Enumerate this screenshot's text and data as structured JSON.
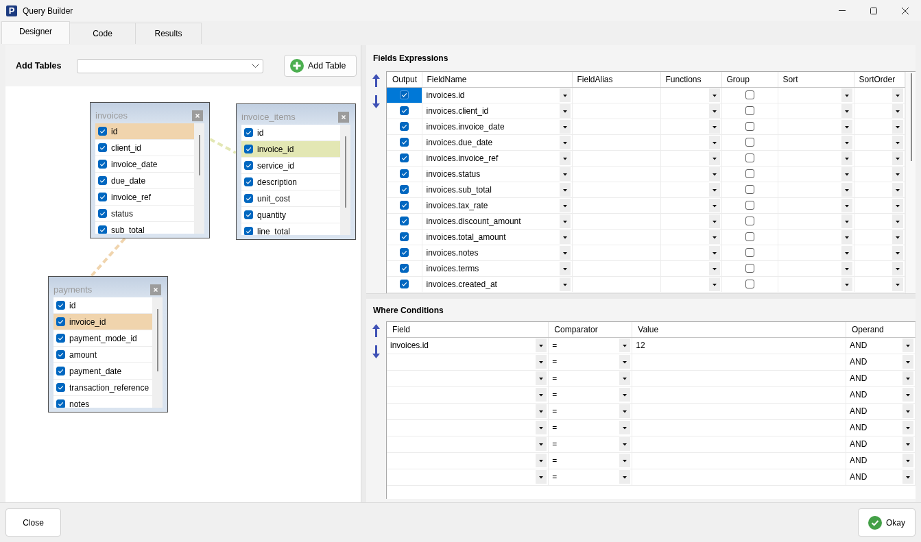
{
  "window": {
    "logo": "P",
    "title": "Query Builder"
  },
  "tabs": [
    {
      "label": "Designer",
      "selected": true
    },
    {
      "label": "Code",
      "selected": false
    },
    {
      "label": "Results",
      "selected": false
    }
  ],
  "designer": {
    "add_tables_label": "Add Tables",
    "add_table_button": "Add Table",
    "tables": [
      {
        "name": "invoices",
        "fields": [
          {
            "name": "id",
            "checked": true,
            "color": "#f0d4ad"
          },
          {
            "name": "client_id",
            "checked": true
          },
          {
            "name": "invoice_date",
            "checked": true
          },
          {
            "name": "due_date",
            "checked": true
          },
          {
            "name": "invoice_ref",
            "checked": true
          },
          {
            "name": "status",
            "checked": true
          },
          {
            "name": "sub_total",
            "checked": true
          }
        ]
      },
      {
        "name": "invoice_items",
        "fields": [
          {
            "name": "id",
            "checked": true
          },
          {
            "name": "invoice_id",
            "checked": true,
            "color": "#e3e7b4"
          },
          {
            "name": "service_id",
            "checked": true
          },
          {
            "name": "description",
            "checked": true
          },
          {
            "name": "unit_cost",
            "checked": true
          },
          {
            "name": "quantity",
            "checked": true
          },
          {
            "name": "line_total",
            "checked": true
          }
        ]
      },
      {
        "name": "payments",
        "fields": [
          {
            "name": "id",
            "checked": true
          },
          {
            "name": "invoice_id",
            "checked": true,
            "color": "#f0d4ad"
          },
          {
            "name": "payment_mode_id",
            "checked": true
          },
          {
            "name": "amount",
            "checked": true
          },
          {
            "name": "payment_date",
            "checked": true
          },
          {
            "name": "transaction_reference",
            "checked": true
          },
          {
            "name": "notes",
            "checked": true
          }
        ]
      }
    ],
    "relations": [
      {
        "color": "#e3e7b4"
      },
      {
        "color": "#f0d4ad"
      }
    ]
  },
  "fields_expressions": {
    "title": "Fields Expressions",
    "columns": [
      "Output",
      "FieldName",
      "FieldAlias",
      "Functions",
      "Group",
      "Sort",
      "SortOrder"
    ],
    "rows": [
      {
        "field_name": "invoices.id",
        "output": true,
        "group": false,
        "selected": true
      },
      {
        "field_name": "invoices.client_id",
        "output": true,
        "group": false,
        "selected": false
      },
      {
        "field_name": "invoices.invoice_date",
        "output": true,
        "group": false,
        "selected": false
      },
      {
        "field_name": "invoices.due_date",
        "output": true,
        "group": false,
        "selected": false
      },
      {
        "field_name": "invoices.invoice_ref",
        "output": true,
        "group": false,
        "selected": false
      },
      {
        "field_name": "invoices.status",
        "output": true,
        "group": false,
        "selected": false
      },
      {
        "field_name": "invoices.sub_total",
        "output": true,
        "group": false,
        "selected": false
      },
      {
        "field_name": "invoices.tax_rate",
        "output": true,
        "group": false,
        "selected": false
      },
      {
        "field_name": "invoices.discount_amount",
        "output": true,
        "group": false,
        "selected": false
      },
      {
        "field_name": "invoices.total_amount",
        "output": true,
        "group": false,
        "selected": false
      },
      {
        "field_name": "invoices.notes",
        "output": true,
        "group": false,
        "selected": false
      },
      {
        "field_name": "invoices.terms",
        "output": true,
        "group": false,
        "selected": false
      },
      {
        "field_name": "invoices.created_at",
        "output": true,
        "group": false,
        "selected": false
      }
    ]
  },
  "where_conditions": {
    "title": "Where Conditions",
    "columns": [
      "Field",
      "Comparator",
      "Value",
      "Operand"
    ],
    "rows": [
      {
        "field": "invoices.id",
        "comparator": "=",
        "value": "12",
        "operand": "AND"
      },
      {
        "comparator": "=",
        "operand": "AND"
      },
      {
        "comparator": "=",
        "operand": "AND"
      },
      {
        "comparator": "=",
        "operand": "AND"
      },
      {
        "comparator": "=",
        "operand": "AND"
      },
      {
        "comparator": "=",
        "operand": "AND"
      },
      {
        "comparator": "=",
        "operand": "AND"
      },
      {
        "comparator": "=",
        "operand": "AND"
      },
      {
        "comparator": "=",
        "operand": "AND"
      }
    ]
  },
  "buttons": {
    "close": "Close",
    "okay": "Okay"
  }
}
